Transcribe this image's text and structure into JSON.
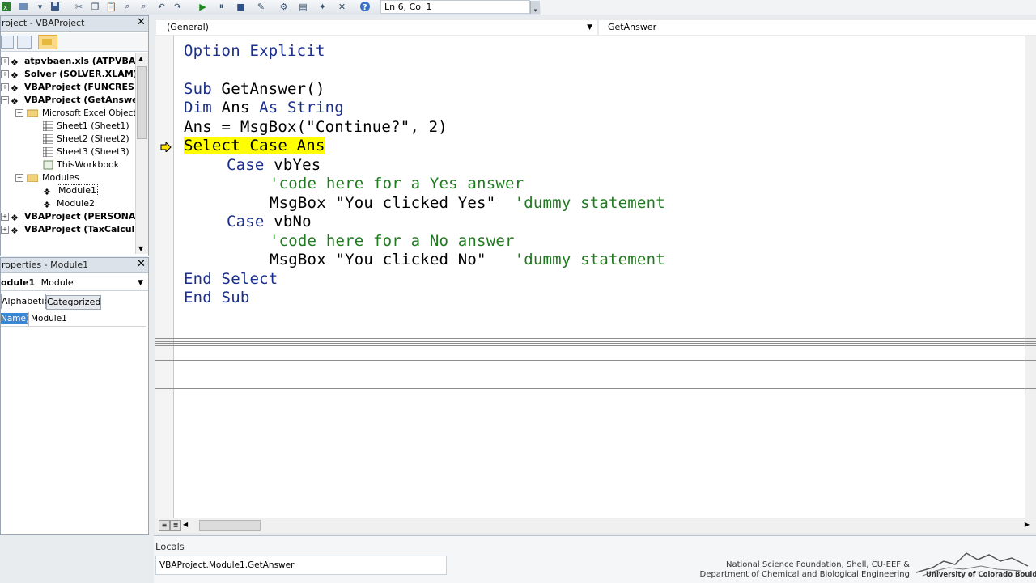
{
  "toolbar": {
    "icons": [
      "excel-icon",
      "insert-module-icon",
      "save-icon",
      "cut-icon",
      "copy-icon",
      "paste-icon",
      "find-icon",
      "undo-icon",
      "redo-icon",
      "run-icon",
      "break-icon",
      "reset-icon",
      "design-mode-icon",
      "project-explorer-icon",
      "properties-icon",
      "object-browser-icon",
      "toolbox-icon",
      "help-icon"
    ],
    "position": "Ln 6, Col 1"
  },
  "project_panel": {
    "title": "roject - VBAProject",
    "tree": [
      {
        "label": "atpvbaen.xls (ATPVBAE",
        "bold": true
      },
      {
        "label": "Solver (SOLVER.XLAM)",
        "bold": true
      },
      {
        "label": "VBAProject (FUNCRES.X",
        "bold": true
      },
      {
        "label": "VBAProject (GetAnswe",
        "bold": true
      },
      {
        "label": "Microsoft Excel Object",
        "bold": false
      },
      {
        "label": "Sheet1 (Sheet1)",
        "bold": false
      },
      {
        "label": "Sheet2 (Sheet2)",
        "bold": false
      },
      {
        "label": "Sheet3 (Sheet3)",
        "bold": false
      },
      {
        "label": "ThisWorkbook",
        "bold": false
      },
      {
        "label": "Modules",
        "bold": false
      },
      {
        "label": "Module1",
        "bold": false
      },
      {
        "label": "Module2",
        "bold": false
      },
      {
        "label": "VBAProject (PERSONAL",
        "bold": true
      },
      {
        "label": "VBAProject (TaxCalcul",
        "bold": true
      }
    ]
  },
  "properties_panel": {
    "title": "roperties - Module1",
    "object_name": "odule1",
    "object_type": "Module",
    "tabs": [
      "Alphabetic",
      "Categorized"
    ],
    "prop_name": "Name)",
    "prop_value": "Module1"
  },
  "code_window": {
    "object_combo": "(General)",
    "procedure_combo": "GetAnswer",
    "lines": {
      "l1": "Option Explicit",
      "l2_kw": "Sub",
      "l2_rest": " GetAnswer()",
      "l3_kw1": "Dim",
      "l3_a": " Ans ",
      "l3_kw2": "As",
      "l3_b": " ",
      "l3_kw3": "String",
      "l4": "Ans = MsgBox(\"Continue?\", 2)",
      "l5": "Select Case Ans",
      "l6_kw": "Case",
      "l6_rest": " vbYes",
      "l7": "'code here for a Yes answer",
      "l8_code": "MsgBox \"You clicked Yes\"  ",
      "l8_cm": "'dummy statement",
      "l9_kw": "Case",
      "l9_rest": " vbNo",
      "l10": "'code here for a No answer",
      "l11_code": "MsgBox \"You clicked No\"   ",
      "l11_cm": "'dummy statement",
      "l12": "End Select",
      "l13": "End Sub"
    }
  },
  "locals": {
    "title": "Locals",
    "context": "VBAProject.Module1.GetAnswer"
  },
  "credits": {
    "line1": "National Science Foundation, Shell, CU-EEF &",
    "line2": "Department of Chemical and Biological Engineering",
    "logo": "University of Colorado Boulder"
  },
  "colors": {
    "keyword": "#1b2f8c",
    "comment": "#1f7a1f",
    "highlight": "#ffff00"
  }
}
